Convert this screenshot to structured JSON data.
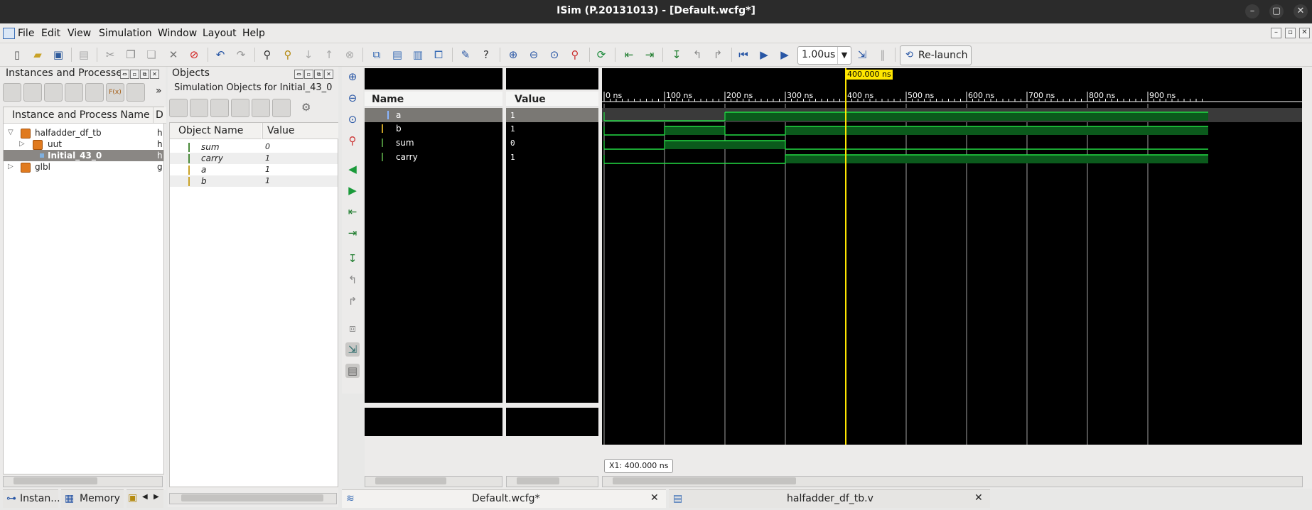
{
  "window": {
    "title": "ISim (P.20131013) - [Default.wcfg*]"
  },
  "menubar": {
    "items": [
      "File",
      "Edit",
      "View",
      "Simulation",
      "Window",
      "Layout",
      "Help"
    ]
  },
  "toolbar": {
    "run_time": "1.00us",
    "relaunch_label": "Re-launch"
  },
  "instances_panel": {
    "title": "Instances and Processes",
    "col_name": "Instance and Process Name",
    "col_d": "D",
    "rows": [
      {
        "name": "halfadder_df_tb",
        "d": "h"
      },
      {
        "name": "uut",
        "d": "h"
      },
      {
        "name": "Initial_43_0",
        "d": "h"
      },
      {
        "name": "glbl",
        "d": "g"
      }
    ],
    "fx_label": "F(x)",
    "more": "»"
  },
  "objects_panel": {
    "title": "Objects",
    "subtitle": "Simulation Objects for Initial_43_0",
    "col_name": "Object Name",
    "col_value": "Value",
    "rows": [
      {
        "name": "sum",
        "value": "0"
      },
      {
        "name": "carry",
        "value": "1"
      },
      {
        "name": "a",
        "value": "1"
      },
      {
        "name": "b",
        "value": "1"
      }
    ]
  },
  "bottom_tabs": {
    "instances": "Instan...",
    "memory": "Memory"
  },
  "wave": {
    "name_header": "Name",
    "value_header": "Value",
    "signals": [
      {
        "name": "a",
        "value": "1"
      },
      {
        "name": "b",
        "value": "1"
      },
      {
        "name": "sum",
        "value": "0"
      },
      {
        "name": "carry",
        "value": "1"
      }
    ],
    "ticks": [
      "0 ns",
      "100 ns",
      "200 ns",
      "300 ns",
      "400 ns",
      "500 ns",
      "600 ns",
      "700 ns",
      "800 ns",
      "900 ns"
    ],
    "cursor_label": "400.000 ns",
    "cursor_readout": "X1: 400.000 ns",
    "cursor_time_ns": 400
  },
  "doc_tabs": {
    "wcfg": "Default.wcfg*",
    "source": "halfadder_df_tb.v"
  }
}
